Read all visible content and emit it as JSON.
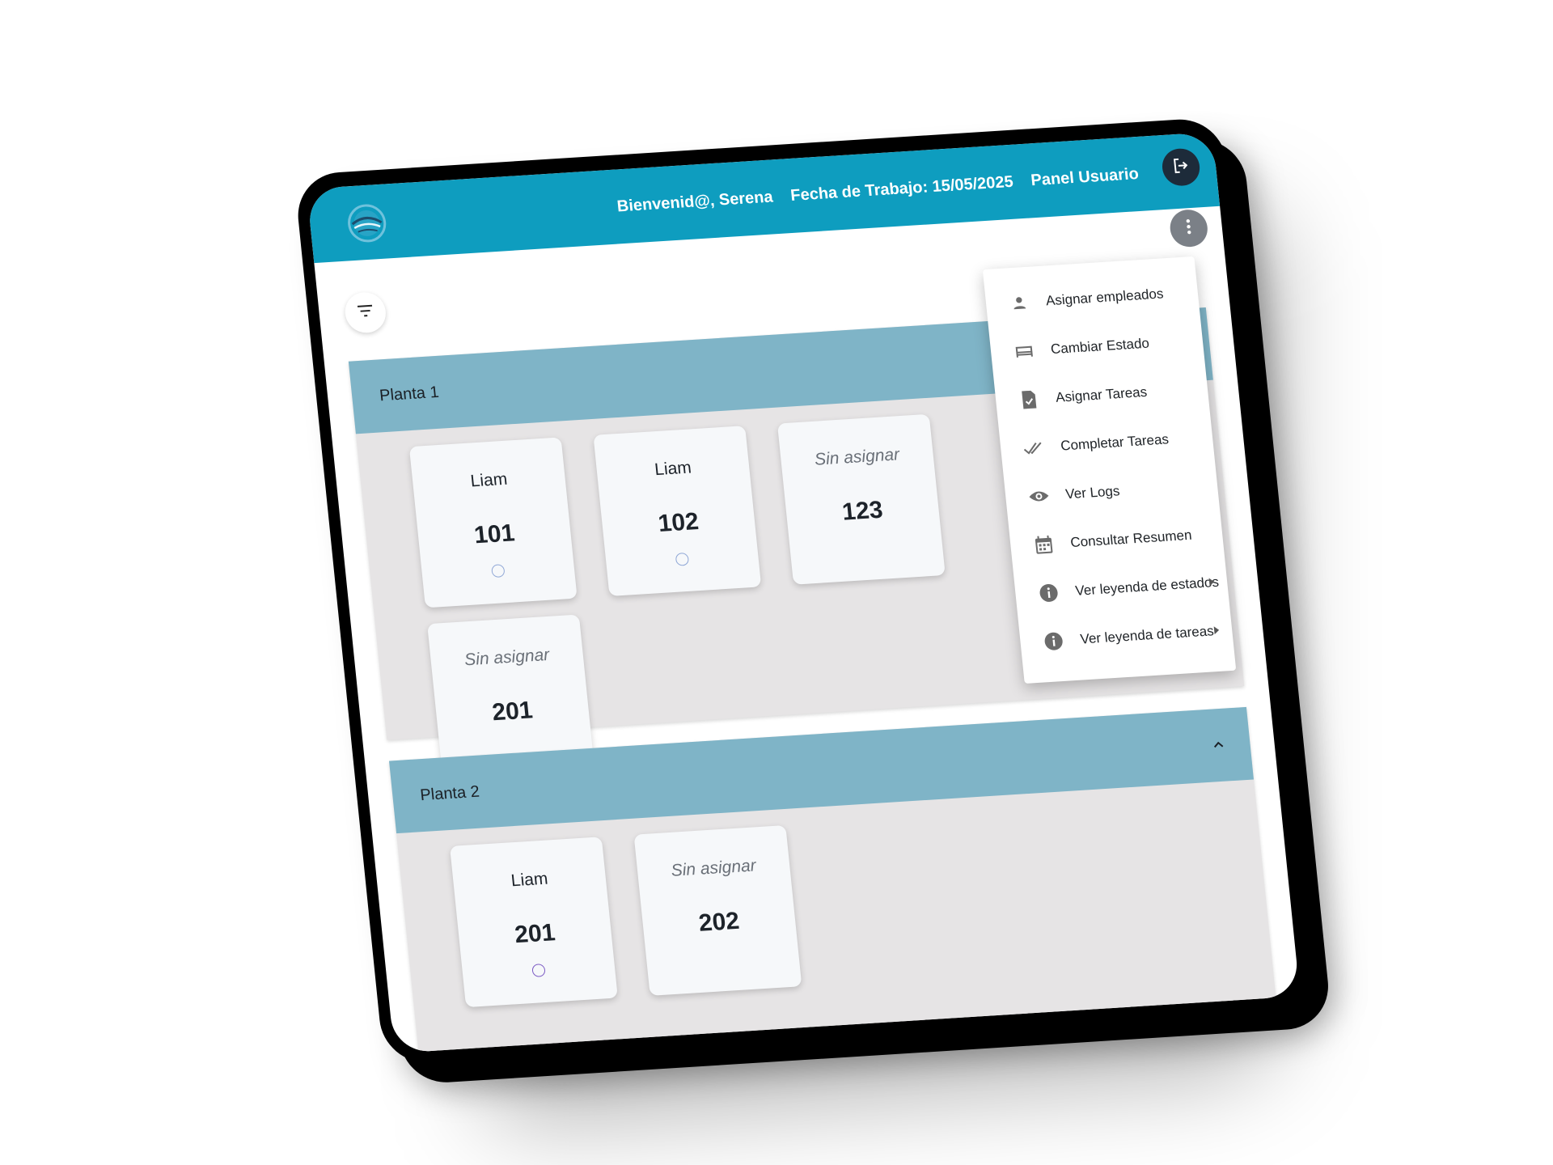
{
  "header": {
    "welcome": "Bienvenid@, Serena",
    "work_date": "Fecha de Trabajo: 15/05/2025",
    "panel": "Panel Usuario"
  },
  "floors": [
    {
      "label": "Planta 1",
      "rooms": [
        {
          "employee": "Liam",
          "number": "101"
        },
        {
          "employee": "Liam",
          "number": "102"
        },
        {
          "employee": "Sin asignar",
          "number": "123"
        },
        {
          "employee": "Sin asignar",
          "number": "201"
        }
      ]
    },
    {
      "label": "Planta 2",
      "rooms": [
        {
          "employee": "Liam",
          "number": "201"
        },
        {
          "employee": "Sin asignar",
          "number": "202"
        }
      ]
    }
  ],
  "menu": {
    "items": [
      {
        "label": "Asignar empleados",
        "icon": "person-icon"
      },
      {
        "label": "Cambiar Estado",
        "icon": "bed-icon"
      },
      {
        "label": "Asignar Tareas",
        "icon": "task-document-icon"
      },
      {
        "label": "Completar Tareas",
        "icon": "double-check-icon"
      },
      {
        "label": "Ver Logs",
        "icon": "eye-icon"
      },
      {
        "label": "Consultar Resumen",
        "icon": "calendar-icon"
      },
      {
        "label": "Ver leyenda de estados",
        "icon": "info-icon"
      },
      {
        "label": "Ver leyenda de tareas",
        "icon": "info-icon"
      }
    ]
  },
  "colors": {
    "topbar": "#0e9dbf",
    "floor_header": "#7fb4c7",
    "floor_body": "#e6e4e5"
  }
}
